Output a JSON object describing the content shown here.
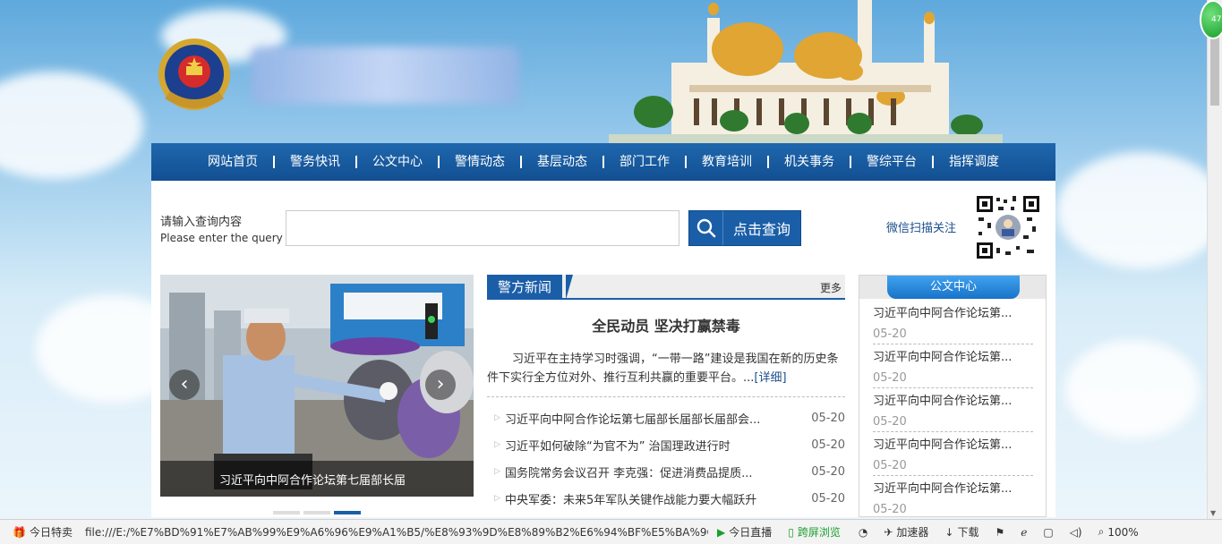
{
  "nav": {
    "items": [
      {
        "label": "网站首页"
      },
      {
        "label": "警务快讯"
      },
      {
        "label": "公文中心"
      },
      {
        "label": "警情动态"
      },
      {
        "label": "基层动态"
      },
      {
        "label": "部门工作"
      },
      {
        "label": "教育培训"
      },
      {
        "label": "机关事务"
      },
      {
        "label": "警综平台"
      },
      {
        "label": "指挥调度"
      }
    ]
  },
  "search": {
    "label_cn": "请输入查询内容",
    "label_en": "Please enter the query",
    "input_value": "",
    "button_label": "点击查询"
  },
  "wechat": {
    "label": "微信扫描关注"
  },
  "slider": {
    "caption": "习近平向中阿合作论坛第七届部长届",
    "prev_glyph": "‹",
    "next_glyph": "›",
    "dot_count": 3,
    "active_dot": 3
  },
  "news": {
    "tab_label": "警方新闻",
    "more_label": "更多",
    "headline_title": "全民动员 坚决打赢禁毒",
    "headline_summary": "习近平在主持学习时强调，“一带一路”建设是我国在新的历史条件下实行全方位对外、推行互利共赢的重要平台。...",
    "headline_detail": "[详细]",
    "items": [
      {
        "title": "习近平向中阿合作论坛第七届部长届部长届部会...",
        "date": "05-20"
      },
      {
        "title": "习近平如何破除“为官不为” 治国理政进行时",
        "date": "05-20"
      },
      {
        "title": "国务院常务会议召开 李克强：促进消费品提质...",
        "date": "05-20"
      },
      {
        "title": "中央军委：未来5年军队关键作战能力要大幅跃升",
        "date": "05-20"
      }
    ]
  },
  "docs": {
    "tab_label": "公文中心",
    "items": [
      {
        "title": "习近平向中阿合作论坛第...",
        "date": "05-20"
      },
      {
        "title": "习近平向中阿合作论坛第...",
        "date": "05-20"
      },
      {
        "title": "习近平向中阿合作论坛第...",
        "date": "05-20"
      },
      {
        "title": "习近平向中阿合作论坛第...",
        "date": "05-20"
      },
      {
        "title": "习近平向中阿合作论坛第...",
        "date": "05-20"
      }
    ]
  },
  "browser": {
    "badge": "47",
    "statusbar": {
      "today_deals": "今日特卖",
      "url": "file:///E:/%E7%BD%91%E7%AB%99%E9%A6%96%E9%A1%B5/%E8%93%9D%E8%89%B2%E6%94%BF%E5%BA%9C%E8%",
      "live": "今日直播",
      "cross_screen": "跨屏浏览",
      "accelerator": "加速器",
      "download": "下载",
      "zoom": "100%"
    }
  },
  "colors": {
    "nav_bg": "#124f92",
    "accent": "#1b5ea8",
    "docs_tab": "#1773c9",
    "live_green": "#1b9f2e"
  },
  "icons": {
    "emblem": "police-emblem-icon",
    "search": "search-icon",
    "qr": "qr-code-icon",
    "more": "more-link"
  }
}
